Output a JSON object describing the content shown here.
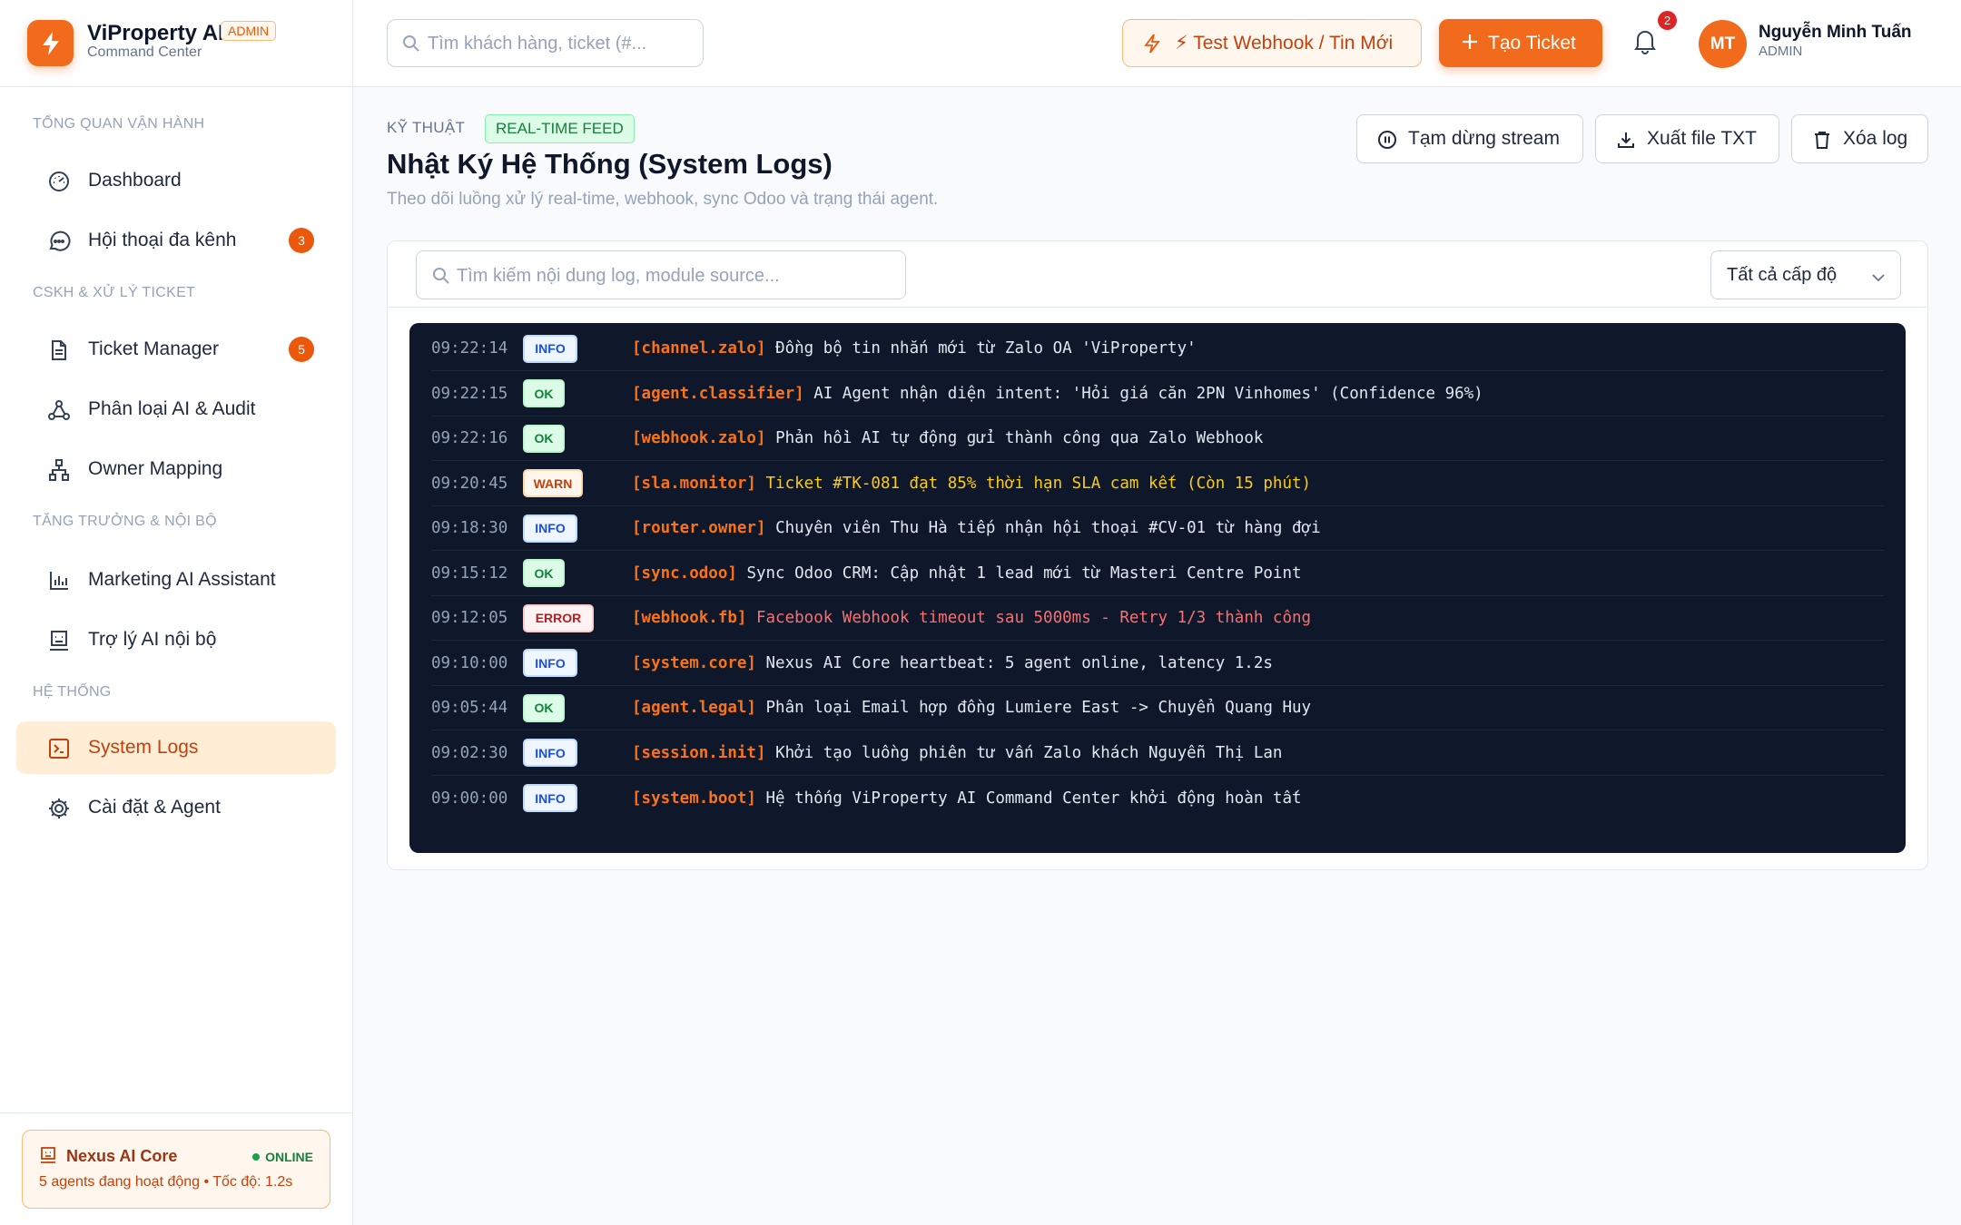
{
  "brand": {
    "name": "ViProperty AI",
    "badge": "ADMIN",
    "subtitle": "Command Center"
  },
  "sidebar": {
    "sections": [
      {
        "title": "TỔNG QUAN VẬN HÀNH"
      },
      {
        "title": "CSKH & XỬ LÝ TICKET"
      },
      {
        "title": "TĂNG TRƯỞNG & NỘI BỘ"
      },
      {
        "title": "HỆ THỐNG"
      }
    ],
    "items": [
      {
        "label": "Dashboard",
        "icon": "gauge-icon"
      },
      {
        "label": "Hội thoại đa kênh",
        "icon": "chat-icon",
        "count": "3"
      },
      {
        "label": "Ticket Manager",
        "icon": "document-icon",
        "count": "5"
      },
      {
        "label": "Phân loại AI & Audit",
        "icon": "network-icon"
      },
      {
        "label": "Owner Mapping",
        "icon": "sitemap-icon"
      },
      {
        "label": "Marketing AI Assistant",
        "icon": "bar-chart-icon"
      },
      {
        "label": "Trợ lý AI nội bộ",
        "icon": "robot-icon"
      },
      {
        "label": "System Logs",
        "icon": "terminal-icon",
        "active": true
      },
      {
        "label": "Cài đặt & Agent",
        "icon": "gear-icon"
      }
    ],
    "core": {
      "title": "Nexus AI Core",
      "status": "ONLINE",
      "subtitle": "5 agents đang hoạt động • Tốc độ: 1.2s"
    }
  },
  "header": {
    "search_placeholder": "Tìm khách hàng, ticket (#...",
    "webhook_label": "⚡ Test Webhook / Tin Mới",
    "create_label": "Tạo Ticket",
    "notification_count": "2",
    "user": {
      "initials": "MT",
      "name": "Nguyễn Minh Tuấn",
      "role": "ADMIN"
    }
  },
  "page": {
    "eyebrow": "KỸ THUẬT",
    "badge": "REAL-TIME FEED",
    "title": "Nhật Ký Hệ Thống (System Logs)",
    "subtitle": "Theo dõi luồng xử lý real-time, webhook, sync Odoo và trạng thái agent.",
    "actions": {
      "pause": "Tạm dừng stream",
      "export": "Xuất file TXT",
      "clear": "Xóa log"
    }
  },
  "logs": {
    "search_placeholder": "Tìm kiếm nội dung log, module source...",
    "level_filter": "Tất cả cấp độ",
    "rows": [
      {
        "time": "09:22:14",
        "level": "INFO",
        "source": "[channel.zalo]",
        "message": "Đồng bộ tin nhắn mới từ Zalo OA 'ViProperty'"
      },
      {
        "time": "09:22:15",
        "level": "OK",
        "source": "[agent.classifier]",
        "message": "AI Agent nhận diện intent: 'Hỏi giá căn 2PN Vinhomes' (Confidence 96%)"
      },
      {
        "time": "09:22:16",
        "level": "OK",
        "source": "[webhook.zalo]",
        "message": "Phản hồi AI tự động gửi thành công qua Zalo Webhook"
      },
      {
        "time": "09:20:45",
        "level": "WARN",
        "source": "[sla.monitor]",
        "message": "Ticket #TK-081 đạt 85% thời hạn SLA cam kết (Còn 15 phút)"
      },
      {
        "time": "09:18:30",
        "level": "INFO",
        "source": "[router.owner]",
        "message": "Chuyên viên Thu Hà tiếp nhận hội thoại #CV-01 từ hàng đợi"
      },
      {
        "time": "09:15:12",
        "level": "OK",
        "source": "[sync.odoo]",
        "message": "Sync Odoo CRM: Cập nhật 1 lead mới từ Masteri Centre Point"
      },
      {
        "time": "09:12:05",
        "level": "ERROR",
        "source": "[webhook.fb]",
        "message": "Facebook Webhook timeout sau 5000ms - Retry 1/3 thành công"
      },
      {
        "time": "09:10:00",
        "level": "INFO",
        "source": "[system.core]",
        "message": "Nexus AI Core heartbeat: 5 agent online, latency 1.2s"
      },
      {
        "time": "09:05:44",
        "level": "OK",
        "source": "[agent.legal]",
        "message": "Phân loại Email hợp đồng Lumiere East -> Chuyển Quang Huy"
      },
      {
        "time": "09:02:30",
        "level": "INFO",
        "source": "[session.init]",
        "message": "Khởi tạo luồng phiên tư vấn Zalo khách Nguyễn Thị Lan"
      },
      {
        "time": "09:00:00",
        "level": "INFO",
        "source": "[system.boot]",
        "message": "Hệ thống ViProperty AI Command Center khởi động hoàn tất"
      }
    ]
  },
  "colors": {
    "accent": "#f26a1b",
    "terminal_bg": "#0f172a",
    "source": "#f97316",
    "warn_text": "#facc15",
    "error_text": "#f87171"
  }
}
